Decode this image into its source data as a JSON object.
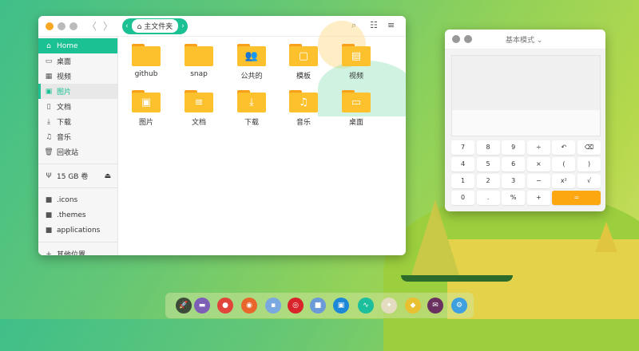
{
  "file_manager": {
    "breadcrumb": "主文件夹",
    "nav": {
      "back": "〈",
      "forward": "〉",
      "crumb_left": "‹",
      "crumb_right": "›"
    },
    "toolbar": {
      "search_icon": "search-icon",
      "grid_icon": "list-view-icon",
      "menu_icon": "menu-icon"
    },
    "sidebar": {
      "places": [
        {
          "label": "Home",
          "icon": "home-icon"
        },
        {
          "label": "桌面",
          "icon": "desktop-icon"
        },
        {
          "label": "视频",
          "icon": "video-icon"
        },
        {
          "label": "图片",
          "icon": "picture-icon"
        },
        {
          "label": "文档",
          "icon": "document-icon"
        },
        {
          "label": "下载",
          "icon": "download-icon"
        },
        {
          "label": "音乐",
          "icon": "music-icon"
        },
        {
          "label": "回收站",
          "icon": "trash-icon"
        }
      ],
      "device": {
        "label": "15 GB 卷",
        "icon": "usb-icon",
        "eject": "⏏"
      },
      "bookmarks": [
        {
          "label": ".icons"
        },
        {
          "label": ".themes"
        },
        {
          "label": "applications"
        }
      ],
      "other": {
        "label": "其他位置",
        "icon": "+"
      }
    },
    "items": [
      {
        "label": "github",
        "glyph": ""
      },
      {
        "label": "snap",
        "glyph": ""
      },
      {
        "label": "公共的",
        "glyph": "👥"
      },
      {
        "label": "模板",
        "glyph": "▢"
      },
      {
        "label": "视频",
        "glyph": "▤"
      },
      {
        "label": "图片",
        "glyph": "▣"
      },
      {
        "label": "文档",
        "glyph": "≡"
      },
      {
        "label": "下载",
        "glyph": "⤓"
      },
      {
        "label": "音乐",
        "glyph": "♫"
      },
      {
        "label": "桌面",
        "glyph": "▭"
      }
    ]
  },
  "calculator": {
    "mode": "基本模式",
    "keys": [
      [
        "7",
        "8",
        "9",
        "÷",
        "↶",
        "⌫"
      ],
      [
        "4",
        "5",
        "6",
        "×",
        "(",
        ")"
      ],
      [
        "1",
        "2",
        "3",
        "−",
        "x²",
        "√"
      ],
      [
        "0",
        ".",
        "%",
        "+",
        "="
      ]
    ]
  },
  "dock": {
    "apps": [
      {
        "name": "launcher",
        "color": "#3d4a3a",
        "glyph": "🚀"
      },
      {
        "name": "file-manager",
        "color": "#7e5fb8",
        "glyph": "▬"
      },
      {
        "name": "chrome",
        "color": "#e0443a",
        "glyph": "●"
      },
      {
        "name": "firefox",
        "color": "#e8662b",
        "glyph": "◉"
      },
      {
        "name": "app-store",
        "color": "#7aa8e0",
        "glyph": "▪"
      },
      {
        "name": "netease-music",
        "color": "#d8232a",
        "glyph": "◎"
      },
      {
        "name": "archive",
        "color": "#6a9ad8",
        "glyph": "■"
      },
      {
        "name": "screenshot",
        "color": "#1e88d8",
        "glyph": "▣"
      },
      {
        "name": "system-monitor",
        "color": "#1bbf9c",
        "glyph": "∿"
      },
      {
        "name": "image-viewer",
        "color": "#e4dcc0",
        "glyph": "✦"
      },
      {
        "name": "notes",
        "color": "#e8c030",
        "glyph": "◆"
      },
      {
        "name": "mail",
        "color": "#6a3060",
        "glyph": "✉"
      },
      {
        "name": "settings",
        "color": "#3fa0e0",
        "glyph": "⚙"
      }
    ]
  }
}
